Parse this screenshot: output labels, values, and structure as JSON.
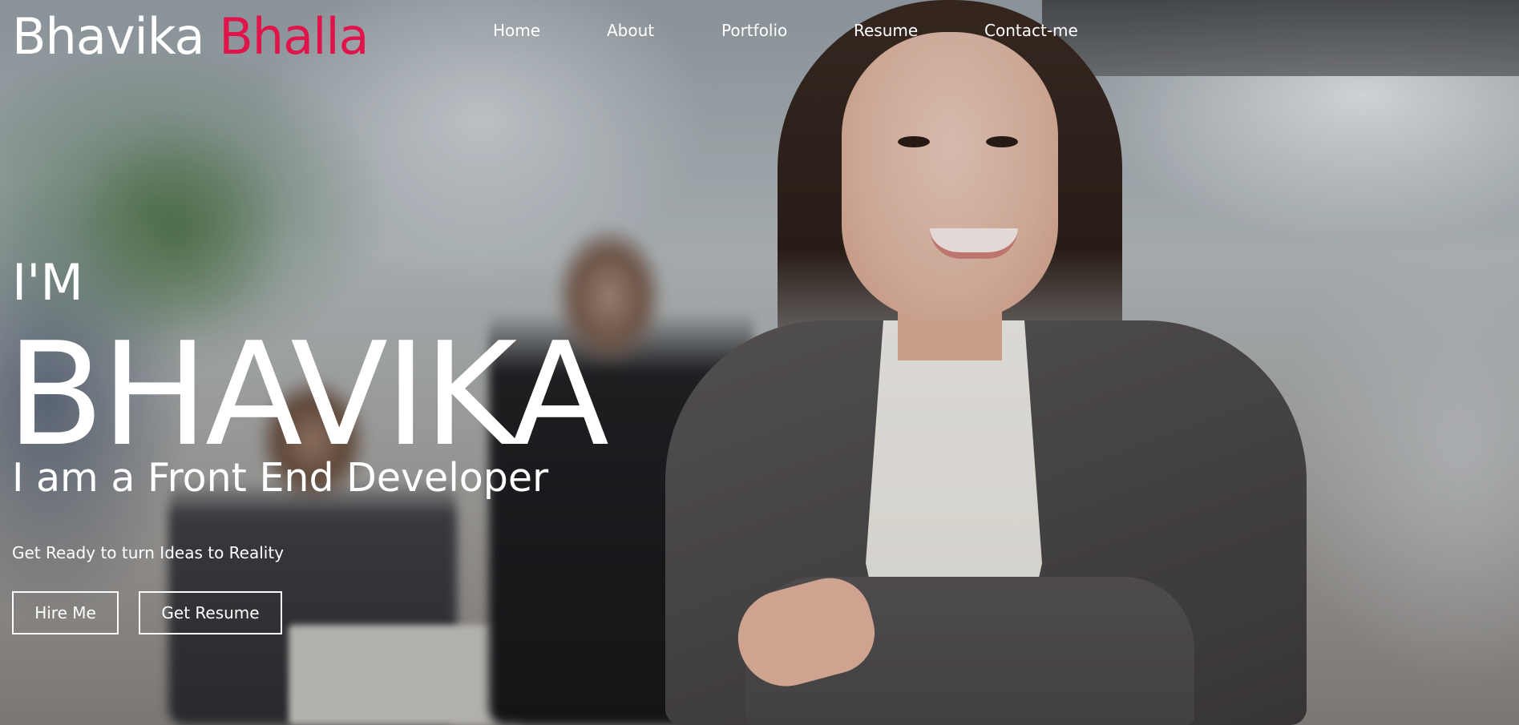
{
  "brand": {
    "first": "Bhavika",
    "last": "Bhalla",
    "accent_color": "#e0134a"
  },
  "nav": {
    "items": [
      {
        "label": "Home"
      },
      {
        "label": "About"
      },
      {
        "label": "Portfolio"
      },
      {
        "label": "Resume"
      },
      {
        "label": "Contact-me"
      }
    ]
  },
  "hero": {
    "intro": "I'M",
    "name": "BHAVIKA",
    "role": "I am a Front End Developer",
    "tagline": "Get Ready to turn Ideas to Reality",
    "buttons": {
      "hire": "Hire Me",
      "resume": "Get Resume"
    }
  }
}
